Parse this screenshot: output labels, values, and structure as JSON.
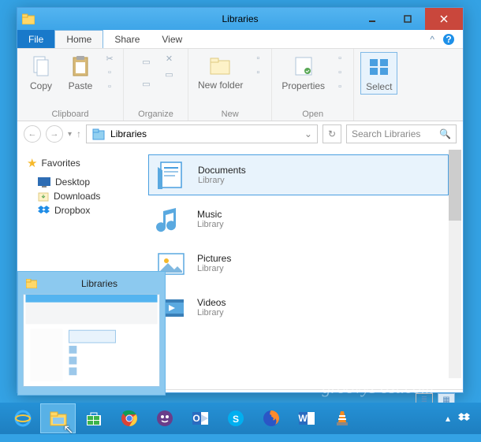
{
  "window": {
    "title": "Libraries",
    "menubar": {
      "file": "File",
      "tabs": [
        "Home",
        "Share",
        "View"
      ],
      "active": 0
    },
    "ribbon": {
      "groups": [
        {
          "label": "Clipboard",
          "buttons": [
            "Copy",
            "Paste"
          ]
        },
        {
          "label": "Organize"
        },
        {
          "label": "New",
          "buttons": [
            "New folder"
          ]
        },
        {
          "label": "Open",
          "buttons": [
            "Properties"
          ]
        },
        {
          "label": "",
          "buttons": [
            "Select"
          ]
        }
      ]
    },
    "address": {
      "path": "Libraries",
      "search_placeholder": "Search Libraries"
    },
    "sidebar": {
      "header": "Favorites",
      "items": [
        {
          "icon": "desktop-icon",
          "label": "Desktop"
        },
        {
          "icon": "download-icon",
          "label": "Downloads"
        },
        {
          "icon": "dropbox-icon",
          "label": "Dropbox"
        }
      ]
    },
    "content": {
      "items": [
        {
          "name": "Documents",
          "sub": "Library",
          "selected": true
        },
        {
          "name": "Music",
          "sub": "Library"
        },
        {
          "name": "Pictures",
          "sub": "Library"
        },
        {
          "name": "Videos",
          "sub": "Library"
        }
      ]
    }
  },
  "thumb": {
    "title": "Libraries"
  },
  "watermark": "groovyPost.com"
}
